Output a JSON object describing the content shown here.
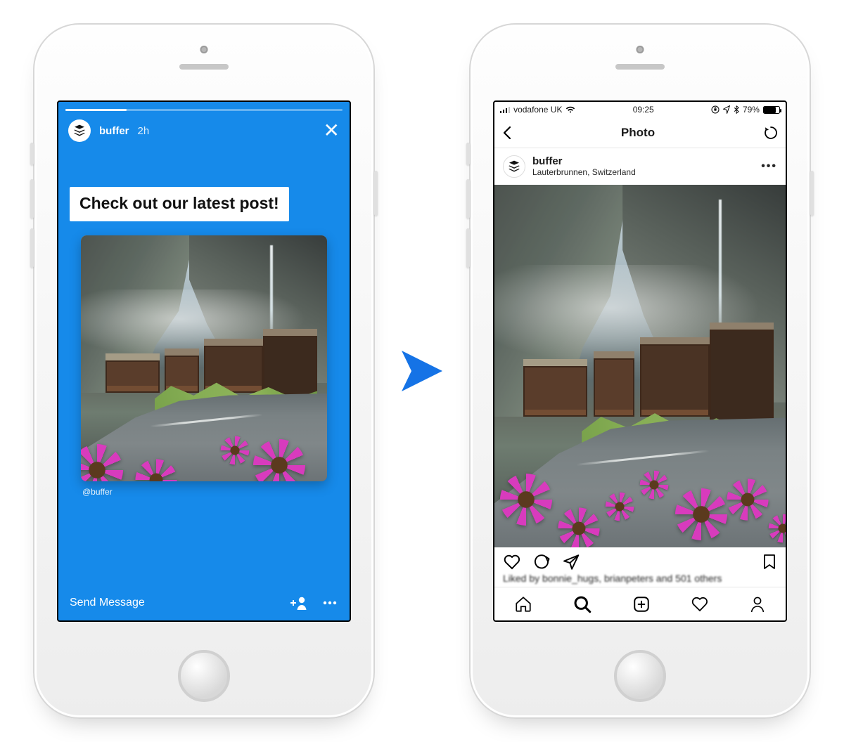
{
  "story": {
    "username": "buffer",
    "timestamp": "2h",
    "cta": "Check out our latest post!",
    "attribution": "@buffer",
    "send_label": "Send Message",
    "close_icon": "✕",
    "add_friend_icon": "add-friend",
    "more_icon": "more"
  },
  "feed": {
    "status": {
      "carrier": "vodafone UK",
      "time": "09:25",
      "battery_pct": "79%"
    },
    "nav_title": "Photo",
    "post": {
      "username": "buffer",
      "location": "Lauterbrunnen, Switzerland",
      "likes_line": "Liked by bonnie_hugs, brianpeters and 501 others"
    }
  }
}
